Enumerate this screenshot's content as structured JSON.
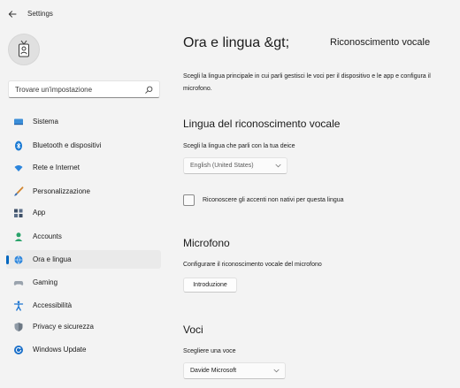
{
  "window": {
    "title": "Settings"
  },
  "search": {
    "placeholder": "Trovare un'impostazione"
  },
  "sidebar": {
    "items": [
      {
        "label": "Sistema",
        "icon": "monitor-icon"
      },
      {
        "label": "Bluetooth e dispositivi",
        "icon": "bluetooth-icon"
      },
      {
        "label": "Rete e Internet",
        "icon": "wifi-icon"
      },
      {
        "label": "Personalizzazione",
        "icon": "brush-icon"
      },
      {
        "label": "App",
        "icon": "apps-icon"
      },
      {
        "label": "Accounts",
        "icon": "person-icon"
      },
      {
        "label": "Ora e lingua",
        "icon": "globe-clock-icon",
        "active": true
      },
      {
        "label": "Gaming",
        "icon": "gamepad-icon"
      },
      {
        "label": "Accessibilità",
        "icon": "accessibility-icon"
      },
      {
        "label": "Privacy e sicurezza",
        "icon": "shield-icon"
      },
      {
        "label": "Windows Update",
        "icon": "update-icon"
      }
    ]
  },
  "header": {
    "breadcrumb": "Ora e lingua &gt;",
    "title": "Riconoscimento vocale",
    "description": "Scegli la lingua principale in cui parli gestisci le voci per il dispositivo e le app e configura il microfono."
  },
  "speech_language": {
    "heading": "Lingua del riconoscimento vocale",
    "prompt": "Scegli la lingua che parli con la tua deice",
    "selected": "English (United States)",
    "accent_checkbox_label": "Riconoscere gli accenti non nativi per questa lingua",
    "accent_checked": false
  },
  "microphone": {
    "heading": "Microfono",
    "prompt": "Configurare il riconoscimento vocale del microfono",
    "button_label": "Introduzione"
  },
  "voices": {
    "heading": "Voci",
    "prompt": "Scegliere una voce",
    "selected": "Davide Microsoft"
  },
  "colors": {
    "accent": "#0067c0",
    "background": "#f3f3f3"
  }
}
